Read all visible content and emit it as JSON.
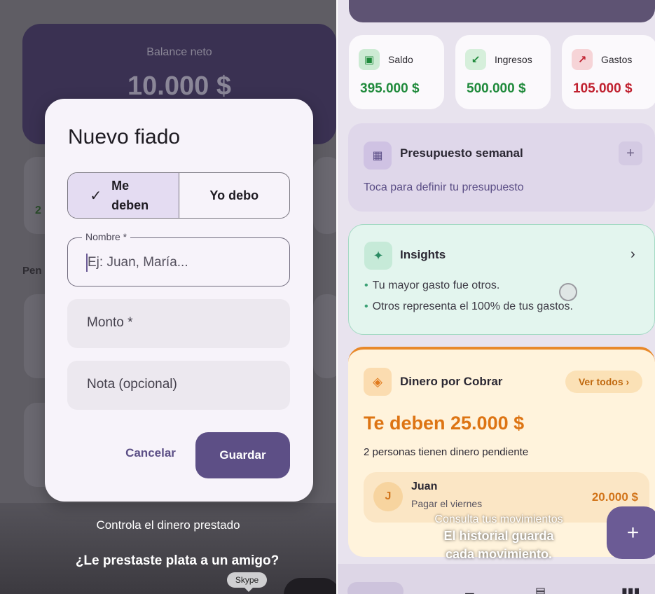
{
  "left": {
    "bg_balance_label": "Balance neto",
    "bg_balance_value": "10.000 $",
    "bg_section": "Pen",
    "bg_digit": "2",
    "dialog": {
      "title": "Nuevo fiado",
      "toggle": {
        "option_me_deben": "Me deben",
        "option_yo_debo": "Yo debo",
        "selected": "Me deben"
      },
      "name_field": {
        "label": "Nombre *",
        "placeholder": "Ej: Juan, María..."
      },
      "amount_field": {
        "placeholder": "Monto *"
      },
      "note_field": {
        "placeholder": "Nota (opcional)"
      },
      "cancel_label": "Cancelar",
      "save_label": "Guardar"
    },
    "caption_1": "Controla el dinero prestado",
    "caption_2": "¿Le prestaste plata a un amigo?",
    "tooltip": "Skype"
  },
  "right": {
    "stats": [
      {
        "label": "Saldo",
        "value": "395.000 $",
        "icon": "wallet-icon",
        "color": "#1f8a3b"
      },
      {
        "label": "Ingresos",
        "value": "500.000 $",
        "icon": "arrow-down-left-icon",
        "color": "#1f8a3b"
      },
      {
        "label": "Gastos",
        "value": "105.000 $",
        "icon": "arrow-up-right-icon",
        "color": "#c0212f"
      }
    ],
    "budget": {
      "title": "Presupuesto semanal",
      "subtitle": "Toca para definir tu presupuesto"
    },
    "insights": {
      "title": "Insights",
      "bullets": [
        "Tu mayor gasto fue otros.",
        "Otros representa el 100% de tus gastos."
      ]
    },
    "receivables": {
      "title": "Dinero por Cobrar",
      "see_all": "Ver todos",
      "total": "Te deben 25.000 $",
      "subtitle": "2 personas tienen dinero pendiente",
      "items": [
        {
          "initial": "J",
          "name": "Juan",
          "note": "Pagar el viernes",
          "amount": "20.000 $"
        }
      ]
    },
    "caption_1": "Consulta tus movimientos",
    "caption_2_line1": "El historial guarda",
    "caption_2_line2": "cada movimiento.",
    "fab": "+"
  },
  "colors": {
    "primary": "#5d4f86",
    "income": "#1f8a3b",
    "expense": "#c0212f",
    "receivable": "#dd7413",
    "insight": "#2b8b63"
  }
}
